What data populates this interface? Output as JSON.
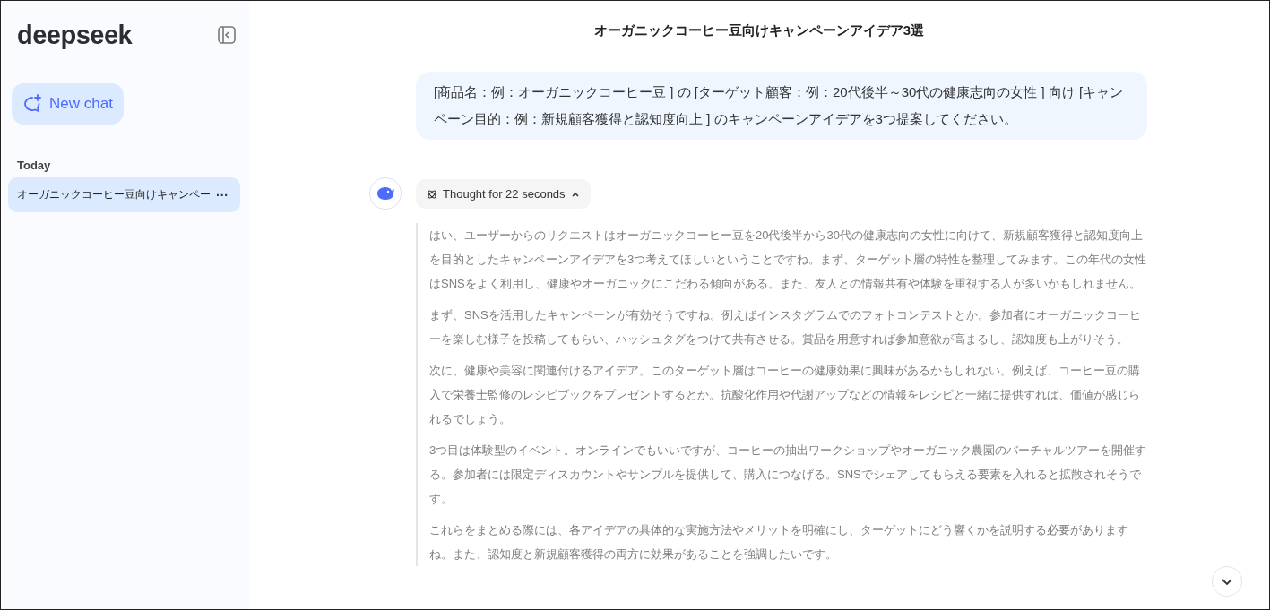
{
  "sidebar": {
    "logo": "deepseek",
    "new_chat": "New chat",
    "sections": [
      {
        "title": "Today",
        "items": [
          {
            "label": "オーガニックコーヒー豆向けキャンペー",
            "selected": true,
            "menu": "···"
          }
        ]
      }
    ]
  },
  "chat": {
    "title": "オーガニックコーヒー豆向けキャンペーンアイデア3選",
    "user_message": "[商品名：例：オーガニックコーヒー豆 ] の [ターゲット顧客：例：20代後半～30代の健康志向の女性 ] 向け [キャンペーン目的：例：新規顧客獲得と認知度向上 ] のキャンペーンアイデアを3つ提案してください。",
    "thought": {
      "label": "Thought for 22 seconds",
      "expanded": true,
      "paragraphs": [
        "はい、ユーザーからのリクエストはオーガニックコーヒー豆を20代後半から30代の健康志向の女性に向けて、新規顧客獲得と認知度向上を目的としたキャンペーンアイデアを3つ考えてほしいということですね。まず、ターゲット層の特性を整理してみます。この年代の女性はSNSをよく利用し、健康やオーガニックにこだわる傾向がある。また、友人との情報共有や体験を重視する人が多いかもしれません。",
        "まず、SNSを活用したキャンペーンが有効そうですね。例えばインスタグラムでのフォトコンテストとか。参加者にオーガニックコーヒーを楽しむ様子を投稿してもらい、ハッシュタグをつけて共有させる。賞品を用意すれば参加意欲が高まるし、認知度も上がりそう。",
        "次に、健康や美容に関連付けるアイデア。このターゲット層はコーヒーの健康効果に興味があるかもしれない。例えば、コーヒー豆の購入で栄養士監修のレシピブックをプレゼントするとか。抗酸化作用や代謝アップなどの情報をレシピと一緒に提供すれば、価値が感じられるでしょう。",
        "3つ目は体験型のイベント。オンラインでもいいですが、コーヒーの抽出ワークショップやオーガニック農園のバーチャルツアーを開催する。参加者には限定ディスカウントやサンプルを提供して、購入につなげる。SNSでシェアしてもらえる要素を入れると拡散されそうです。",
        "これらをまとめる際には、各アイデアの具体的な実施方法やメリットを明確にし、ターゲットにどう響くかを説明する必要がありますね。また、認知度と新規顧客獲得の両方に効果があることを強調したいです。"
      ]
    }
  }
}
